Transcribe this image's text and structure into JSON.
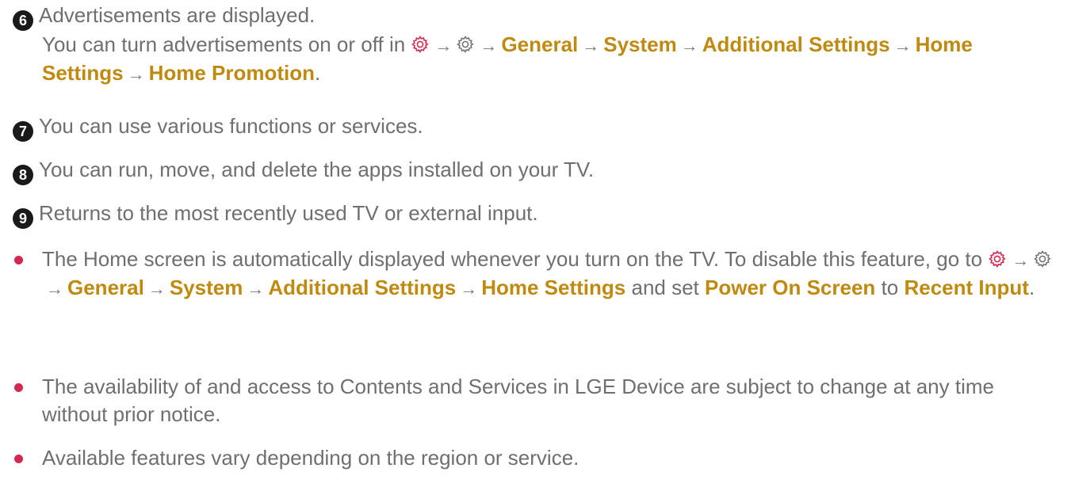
{
  "items": [
    {
      "num": "6",
      "text": "Advertisements are displayed."
    },
    {
      "num": "7",
      "text": "You can use various functions or services."
    },
    {
      "num": "8",
      "text": "You can run, move, and delete the apps installed on your TV."
    },
    {
      "num": "9",
      "text": "Returns to the most recently used TV or external input."
    }
  ],
  "item6_detail": {
    "prefix": "You can turn advertisements on or off in",
    "arrow": "→",
    "path": [
      "General",
      "System",
      "Additional Settings",
      "Home Settings",
      "Home Promotion"
    ],
    "suffix": "."
  },
  "notes": {
    "note1": {
      "text_a": "The Home screen is automatically displayed whenever you turn on the TV. To disable this feature, go to",
      "path": [
        "General",
        "System",
        "Additional Settings",
        "Home Settings"
      ],
      "text_b": "and set",
      "option": "Power On Screen",
      "text_c": "to",
      "value": "Recent Input",
      "suffix": "."
    },
    "note2": "The availability of and access to Contents and Services in LGE Device are subject to change at any time without prior notice.",
    "note3": "Available features vary depending on the region or service."
  },
  "icons": {
    "settings_quick": "settings-gear-icon-red",
    "settings_all": "settings-gear-icon-outline"
  },
  "colors": {
    "accent": "#c08a10",
    "bullet": "#d3284f",
    "text": "#6f6f6f",
    "number_badge": "#1a1a1a"
  }
}
